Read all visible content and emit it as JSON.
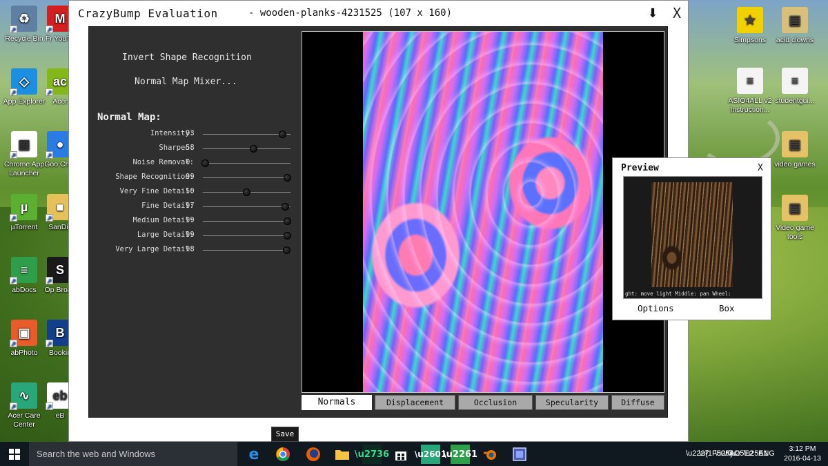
{
  "desktop": {
    "icons_left": [
      {
        "label": "Recycle Bin",
        "color": "#5f7fa3",
        "glyph": "♻"
      },
      {
        "label": "App Explorer",
        "color": "#1d8ee0",
        "glyph": "◇"
      },
      {
        "label": "Chrome App Launcher",
        "color": "#ffffff",
        "glyph": "▦"
      },
      {
        "label": "µTorrent",
        "color": "#5bb031",
        "glyph": "µ"
      },
      {
        "label": "abDocs",
        "color": "#2f9e4b",
        "glyph": "≡"
      },
      {
        "label": "abPhoto",
        "color": "#e85b2a",
        "glyph": "▣"
      },
      {
        "label": "Acer Care Center",
        "color": "#2aa779",
        "glyph": "∿"
      }
    ],
    "icons_second": [
      {
        "label": "Fr YouTu",
        "color": "#d21f1f",
        "glyph": "M"
      },
      {
        "label": "Acer",
        "color": "#83b81a",
        "glyph": "ac"
      },
      {
        "label": "Goo Chro",
        "color": "#2b7be4",
        "glyph": "●"
      },
      {
        "label": "SanDis",
        "color": "#e6c15a",
        "glyph": "■"
      },
      {
        "label": "Op Broad",
        "color": "#1a1a1a",
        "glyph": "S"
      },
      {
        "label": "Bookin",
        "color": "#123e8c",
        "glyph": "B"
      },
      {
        "label": "eB",
        "color": "#ffffff",
        "glyph": "eb"
      }
    ],
    "icons_right": [
      {
        "label": "Simpsons",
        "color": "#f2d100",
        "glyph": "★"
      },
      {
        "label": "acid clowns",
        "color": "#d9c07a",
        "glyph": "▤"
      },
      {
        "label": "ASIO4ALL v2 Instruction...",
        "color": "#f4f4f4",
        "glyph": "≡"
      },
      {
        "label": "studentgui...",
        "color": "#f4f4f4",
        "glyph": "≡"
      },
      {
        "label": "video games",
        "color": "#e5c267",
        "glyph": "▤"
      },
      {
        "label": "Video game tools",
        "color": "#e5c267",
        "glyph": "▤"
      }
    ]
  },
  "window": {
    "title": "CrazyBump Evaluation",
    "file": "- wooden-planks-4231525 (107 x 160)",
    "down_glyph": "⬇",
    "close_glyph": "X"
  },
  "panel": {
    "link_invert": "Invert Shape Recognition",
    "link_mixer": "Normal Map Mixer...",
    "section_title": "Normal Map:",
    "sliders": [
      {
        "label": "Intensity:",
        "value": 93
      },
      {
        "label": "Sharpen:",
        "value": 58
      },
      {
        "label": "Noise Removal:",
        "value": 0
      },
      {
        "label": "Shape Recognition:",
        "value": 99
      },
      {
        "label": "Very Fine Detail:",
        "value": 50
      },
      {
        "label": "Fine Detail:",
        "value": 97
      },
      {
        "label": "Medium Detail:",
        "value": 99
      },
      {
        "label": "Large Detail:",
        "value": 99
      },
      {
        "label": "Very Large Detail:",
        "value": 98
      }
    ]
  },
  "tabs": [
    "Normals",
    "Displacement",
    "Occlusion",
    "Specularity",
    "Diffuse"
  ],
  "preview": {
    "title": "Preview",
    "close_glyph": "X",
    "hint": "ght: move light   Middle: pan      Wheel:",
    "options_label": "Options",
    "box_label": "Box"
  },
  "taskbar": {
    "search_placeholder": "Search the web and Windows",
    "save_tooltip": "Save",
    "lang": "ENG",
    "time": "3:12 PM",
    "date": "2016-04-13"
  }
}
